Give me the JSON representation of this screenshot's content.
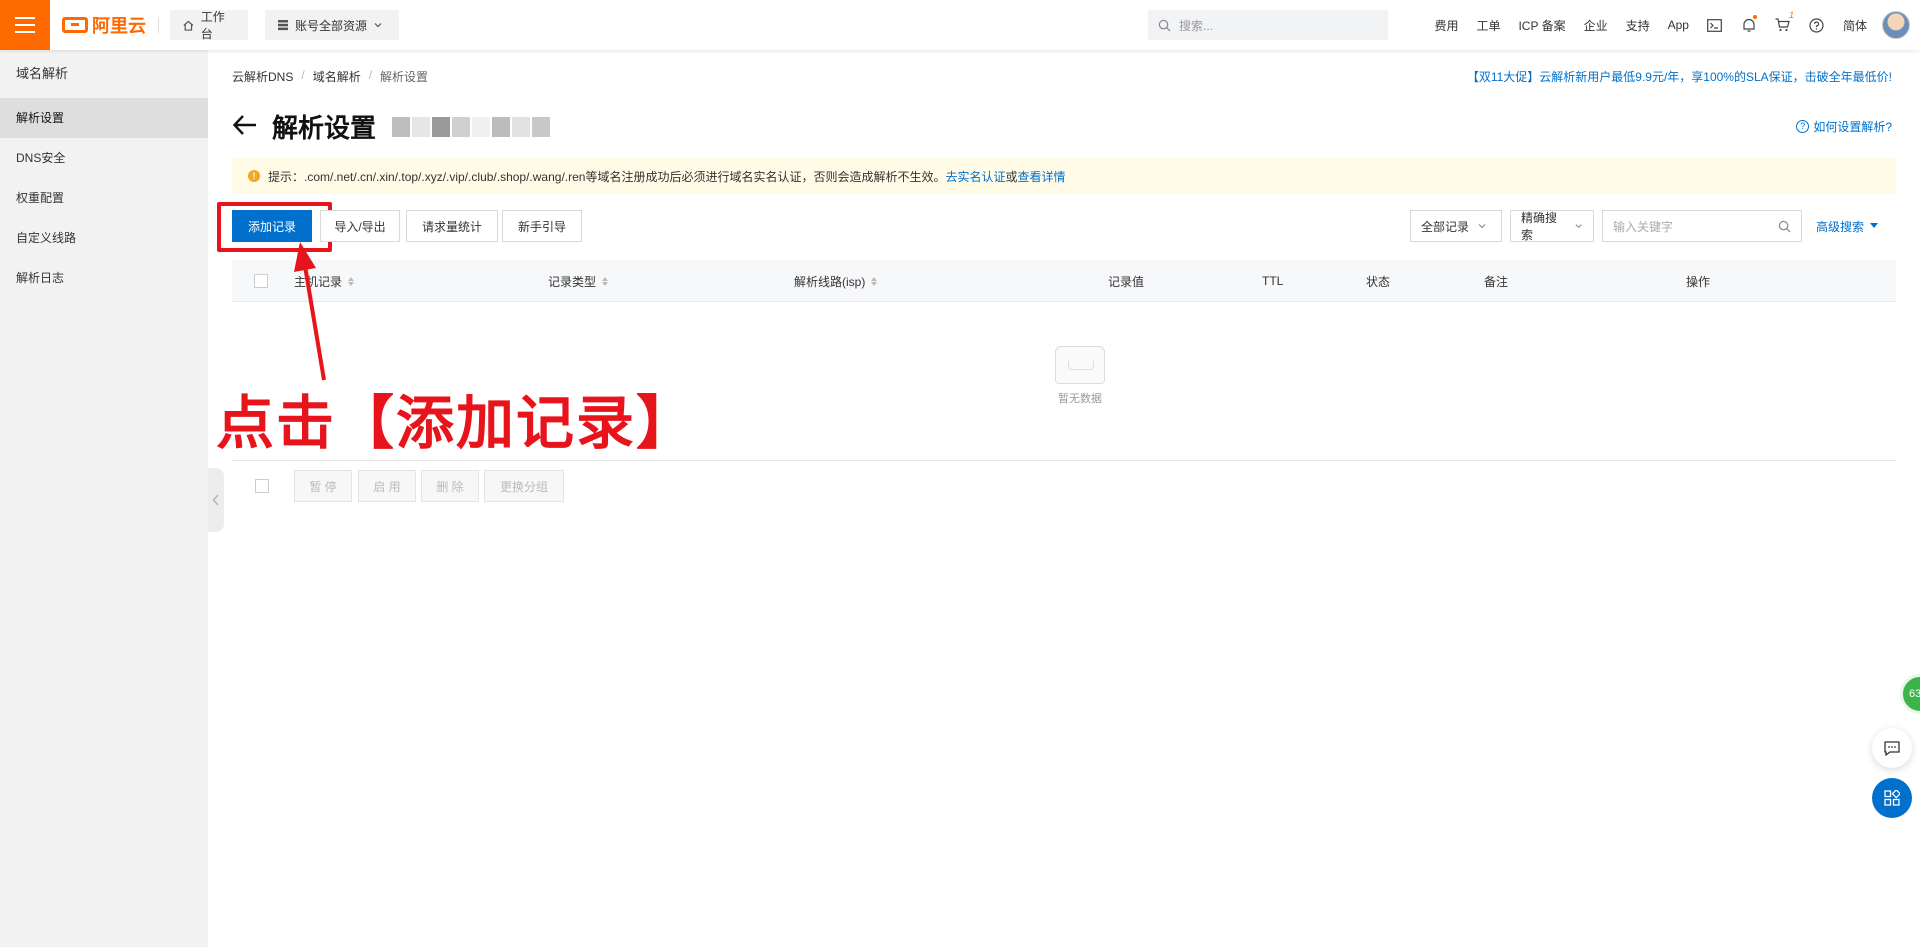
{
  "topbar": {
    "logo_text": "阿里云",
    "workbench_label": "工作台",
    "resources_label": "账号全部资源",
    "search_placeholder": "搜索...",
    "nav": [
      "费用",
      "工单",
      "ICP 备案",
      "企业",
      "支持",
      "App"
    ],
    "cart_count": "1",
    "lang_label": "简体",
    "brand_color": "#ff6a00"
  },
  "sidebar": {
    "title": "域名解析",
    "items": [
      {
        "label": "解析设置",
        "active": true
      },
      {
        "label": "DNS安全"
      },
      {
        "label": "权重配置"
      },
      {
        "label": "自定义线路"
      },
      {
        "label": "解析日志"
      }
    ]
  },
  "breadcrumb": [
    "云解析DNS",
    "域名解析",
    "解析设置"
  ],
  "promo_text": "【双11大促】云解析新用户最低9.9元/年，享100%的SLA保证，击破全年最低价!",
  "page": {
    "title": "解析设置",
    "help_link": "如何设置解析?"
  },
  "notice": {
    "text": "提示：.com/.net/.cn/.xin/.top/.xyz/.vip/.club/.shop/.wang/.ren等域名注册成功后必须进行域名实名认证，否则会造成解析不生效。",
    "link1": "去实名认证",
    "conj": "或",
    "link2": "查看详情"
  },
  "toolbar": {
    "add_record": "添加记录",
    "import_export": "导入/导出",
    "request_stats": "请求量统计",
    "guide": "新手引导",
    "all_records": "全部记录",
    "exact_search": "精确搜索",
    "keyword_placeholder": "输入关键字",
    "advanced_search": "高级搜索"
  },
  "table": {
    "columns": [
      "主机记录",
      "记录类型",
      "解析线路(isp)",
      "记录值",
      "TTL",
      "状态",
      "备注",
      "操作"
    ],
    "empty_text": "暂无数据"
  },
  "batch": [
    "暂 停",
    "启 用",
    "删 除",
    "更换分组"
  ],
  "annotation": {
    "text": "点击【添加记录】",
    "color": "#e8141c"
  },
  "float_badge": "63"
}
